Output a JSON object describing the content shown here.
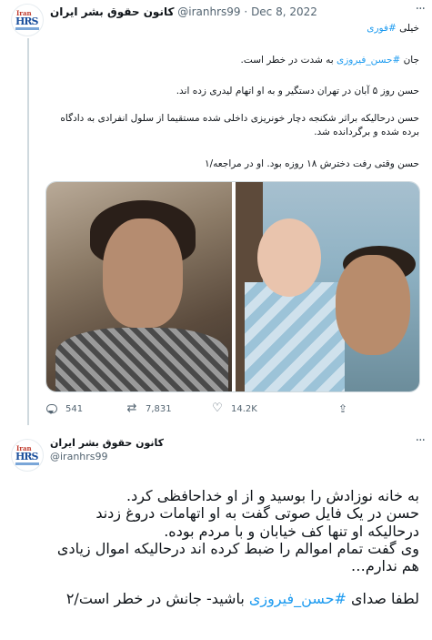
{
  "tweet1": {
    "author_name": "کانون حقوق بشر ایران",
    "handle": "@iranhrs99",
    "date": "Dec 8, 2022",
    "separator": "·",
    "more": "···",
    "tag_line_prefix": "خیلی",
    "tag_line_hashtag": "#فوری",
    "p1_prefix": "جان",
    "p1_hashtag": "#حسن_فیروزی",
    "p1_suffix": "به شدت در خطر است.",
    "p2": "حسن روز ۵ آبان در تهران دستگیر و به او اتهام لیدری زده اند.",
    "p3": "حسن درحالیکه براثر شکنجه دچار خونریزی داخلی شده مستقیما از سلول انفرادی به دادگاه برده شده و برگردانده شد.",
    "p4": "حسن وقتی رفت دخترش ۱۸ روزه بود. او در مراجعه/۱",
    "actions": {
      "replies": "541",
      "retweets": "7,831",
      "likes": "14.2K"
    }
  },
  "tweet2": {
    "author_name": "کانون حقوق بشر ایران",
    "handle": "@iranhrs99",
    "more": "···",
    "line1": "به خانه نوزادش را بوسید و از او خداحافظی کرد.",
    "line2": "حسن در یک فایل صوتی گفت به او اتهامات دروغ زدند",
    "line3": "درحالیکه او تنها کف خیابان و با مردم بوده.",
    "line4": "وی گفت تمام اموالم را ضبط کرده اند درحالیکه اموال زیادی",
    "line5": "هم ندارم…",
    "line6_prefix": "لطفا صدای",
    "line6_hashtag": "#حسن_فیروزی",
    "line6_suffix": "باشید- جانش در خطر است/۲"
  },
  "logo_text": {
    "top": "Iran",
    "main": "HRS"
  },
  "colors": {
    "link": "#1d9bf0",
    "muted": "#536471",
    "text": "#0f1419",
    "thread_line": "#cfd9de"
  },
  "icons": [
    "reply-icon",
    "retweet-icon",
    "like-icon",
    "share-icon",
    "more-icon"
  ]
}
